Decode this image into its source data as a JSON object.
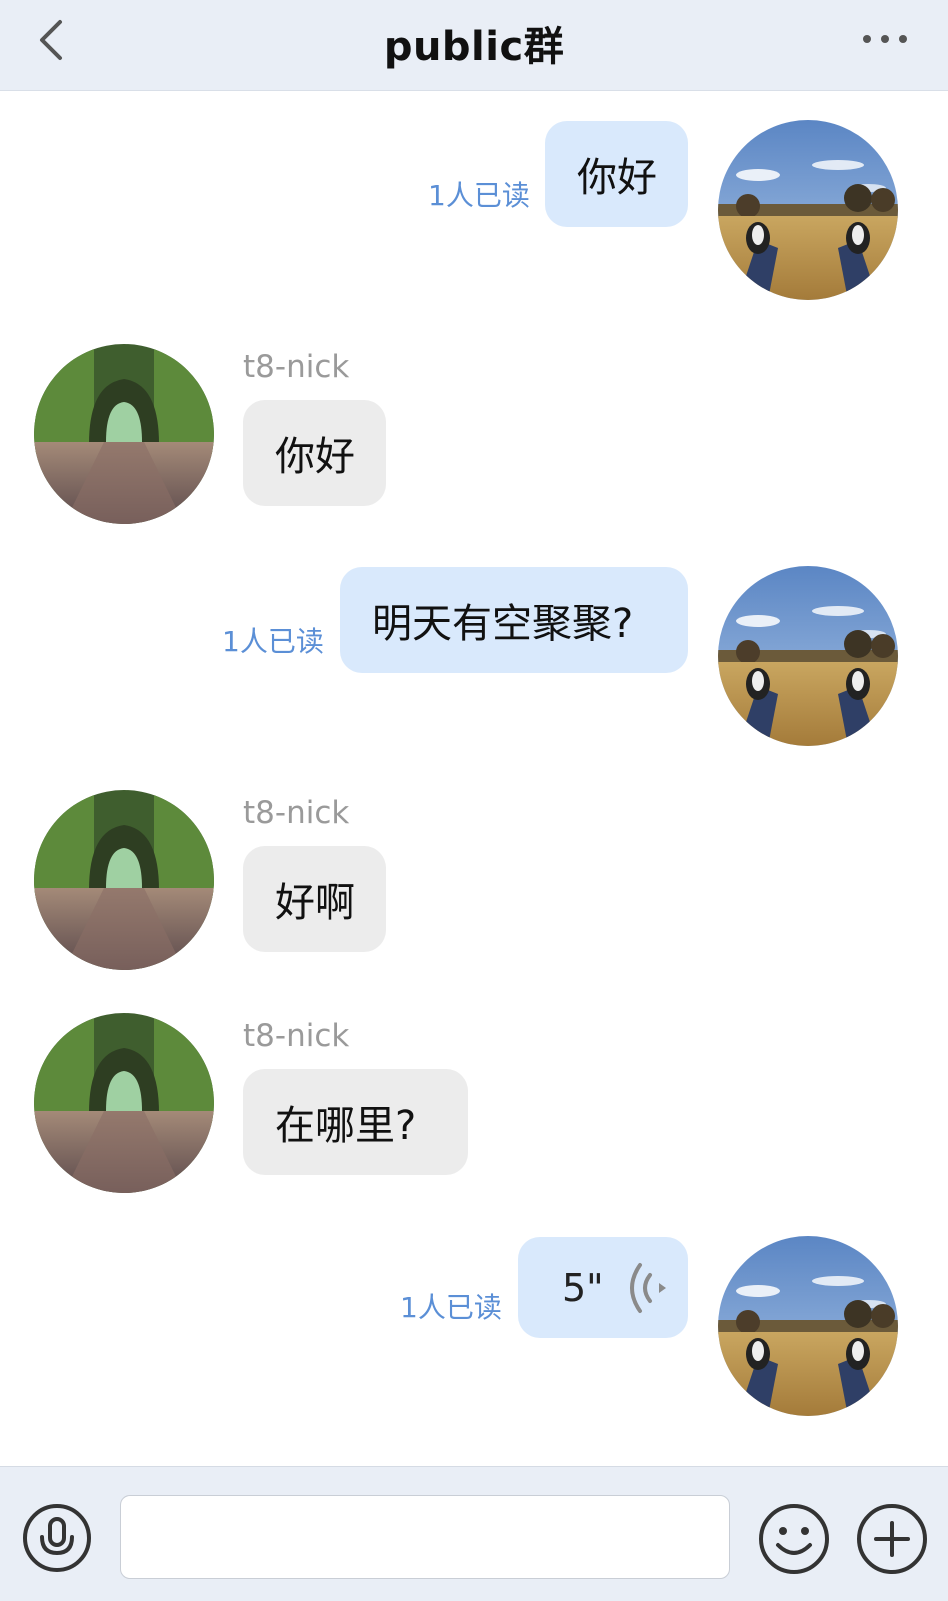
{
  "header": {
    "title": "public群",
    "back_icon": "chevron-left-icon",
    "more_icon": "more-dots-icon"
  },
  "messages": [
    {
      "side": "mine",
      "text": "你好",
      "read_status": "1人已读"
    },
    {
      "side": "theirs",
      "nick": "t8-nick",
      "text": "你好"
    },
    {
      "side": "mine",
      "text": "明天有空聚聚?",
      "read_status": "1人已读"
    },
    {
      "side": "theirs",
      "nick": "t8-nick",
      "text": "好啊"
    },
    {
      "side": "theirs",
      "nick": "t8-nick",
      "text": "在哪里?"
    },
    {
      "side": "mine",
      "type": "voice",
      "duration": "5\"",
      "read_status": "1人已读",
      "voice_icon": "voice-wave-icon"
    }
  ],
  "footer": {
    "mic_icon": "microphone-icon",
    "input_value": "",
    "input_placeholder": "",
    "emoji_icon": "smiley-icon",
    "plus_icon": "plus-circle-icon"
  },
  "colors": {
    "header_bg": "#e9eef6",
    "my_bubble": "#d9e9fc",
    "their_bubble": "#ececec",
    "read_status": "#5b8fd6",
    "nick": "#9a9a9a"
  }
}
